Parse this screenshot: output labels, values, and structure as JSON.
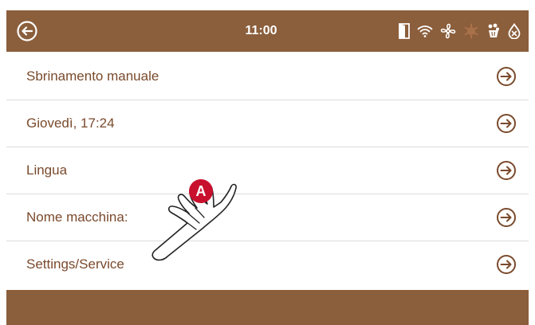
{
  "header": {
    "time": "11:00",
    "icons": [
      "back-arrow-icon",
      "door-icon",
      "wifi-icon",
      "fan-icon",
      "defrost-icon",
      "cleaning-icon",
      "water-drop-icon"
    ],
    "bar_color": "#8b5e3c"
  },
  "menu": {
    "items": [
      {
        "label": "Sbrinamento manuale"
      },
      {
        "label": "Giovedì, 17:24"
      },
      {
        "label": "Lingua"
      },
      {
        "label": "Nome macchina:"
      },
      {
        "label": "Settings/Service"
      }
    ],
    "text_color": "#7a4a2c"
  },
  "callout": {
    "letter": "A",
    "color": "#c8102e"
  }
}
